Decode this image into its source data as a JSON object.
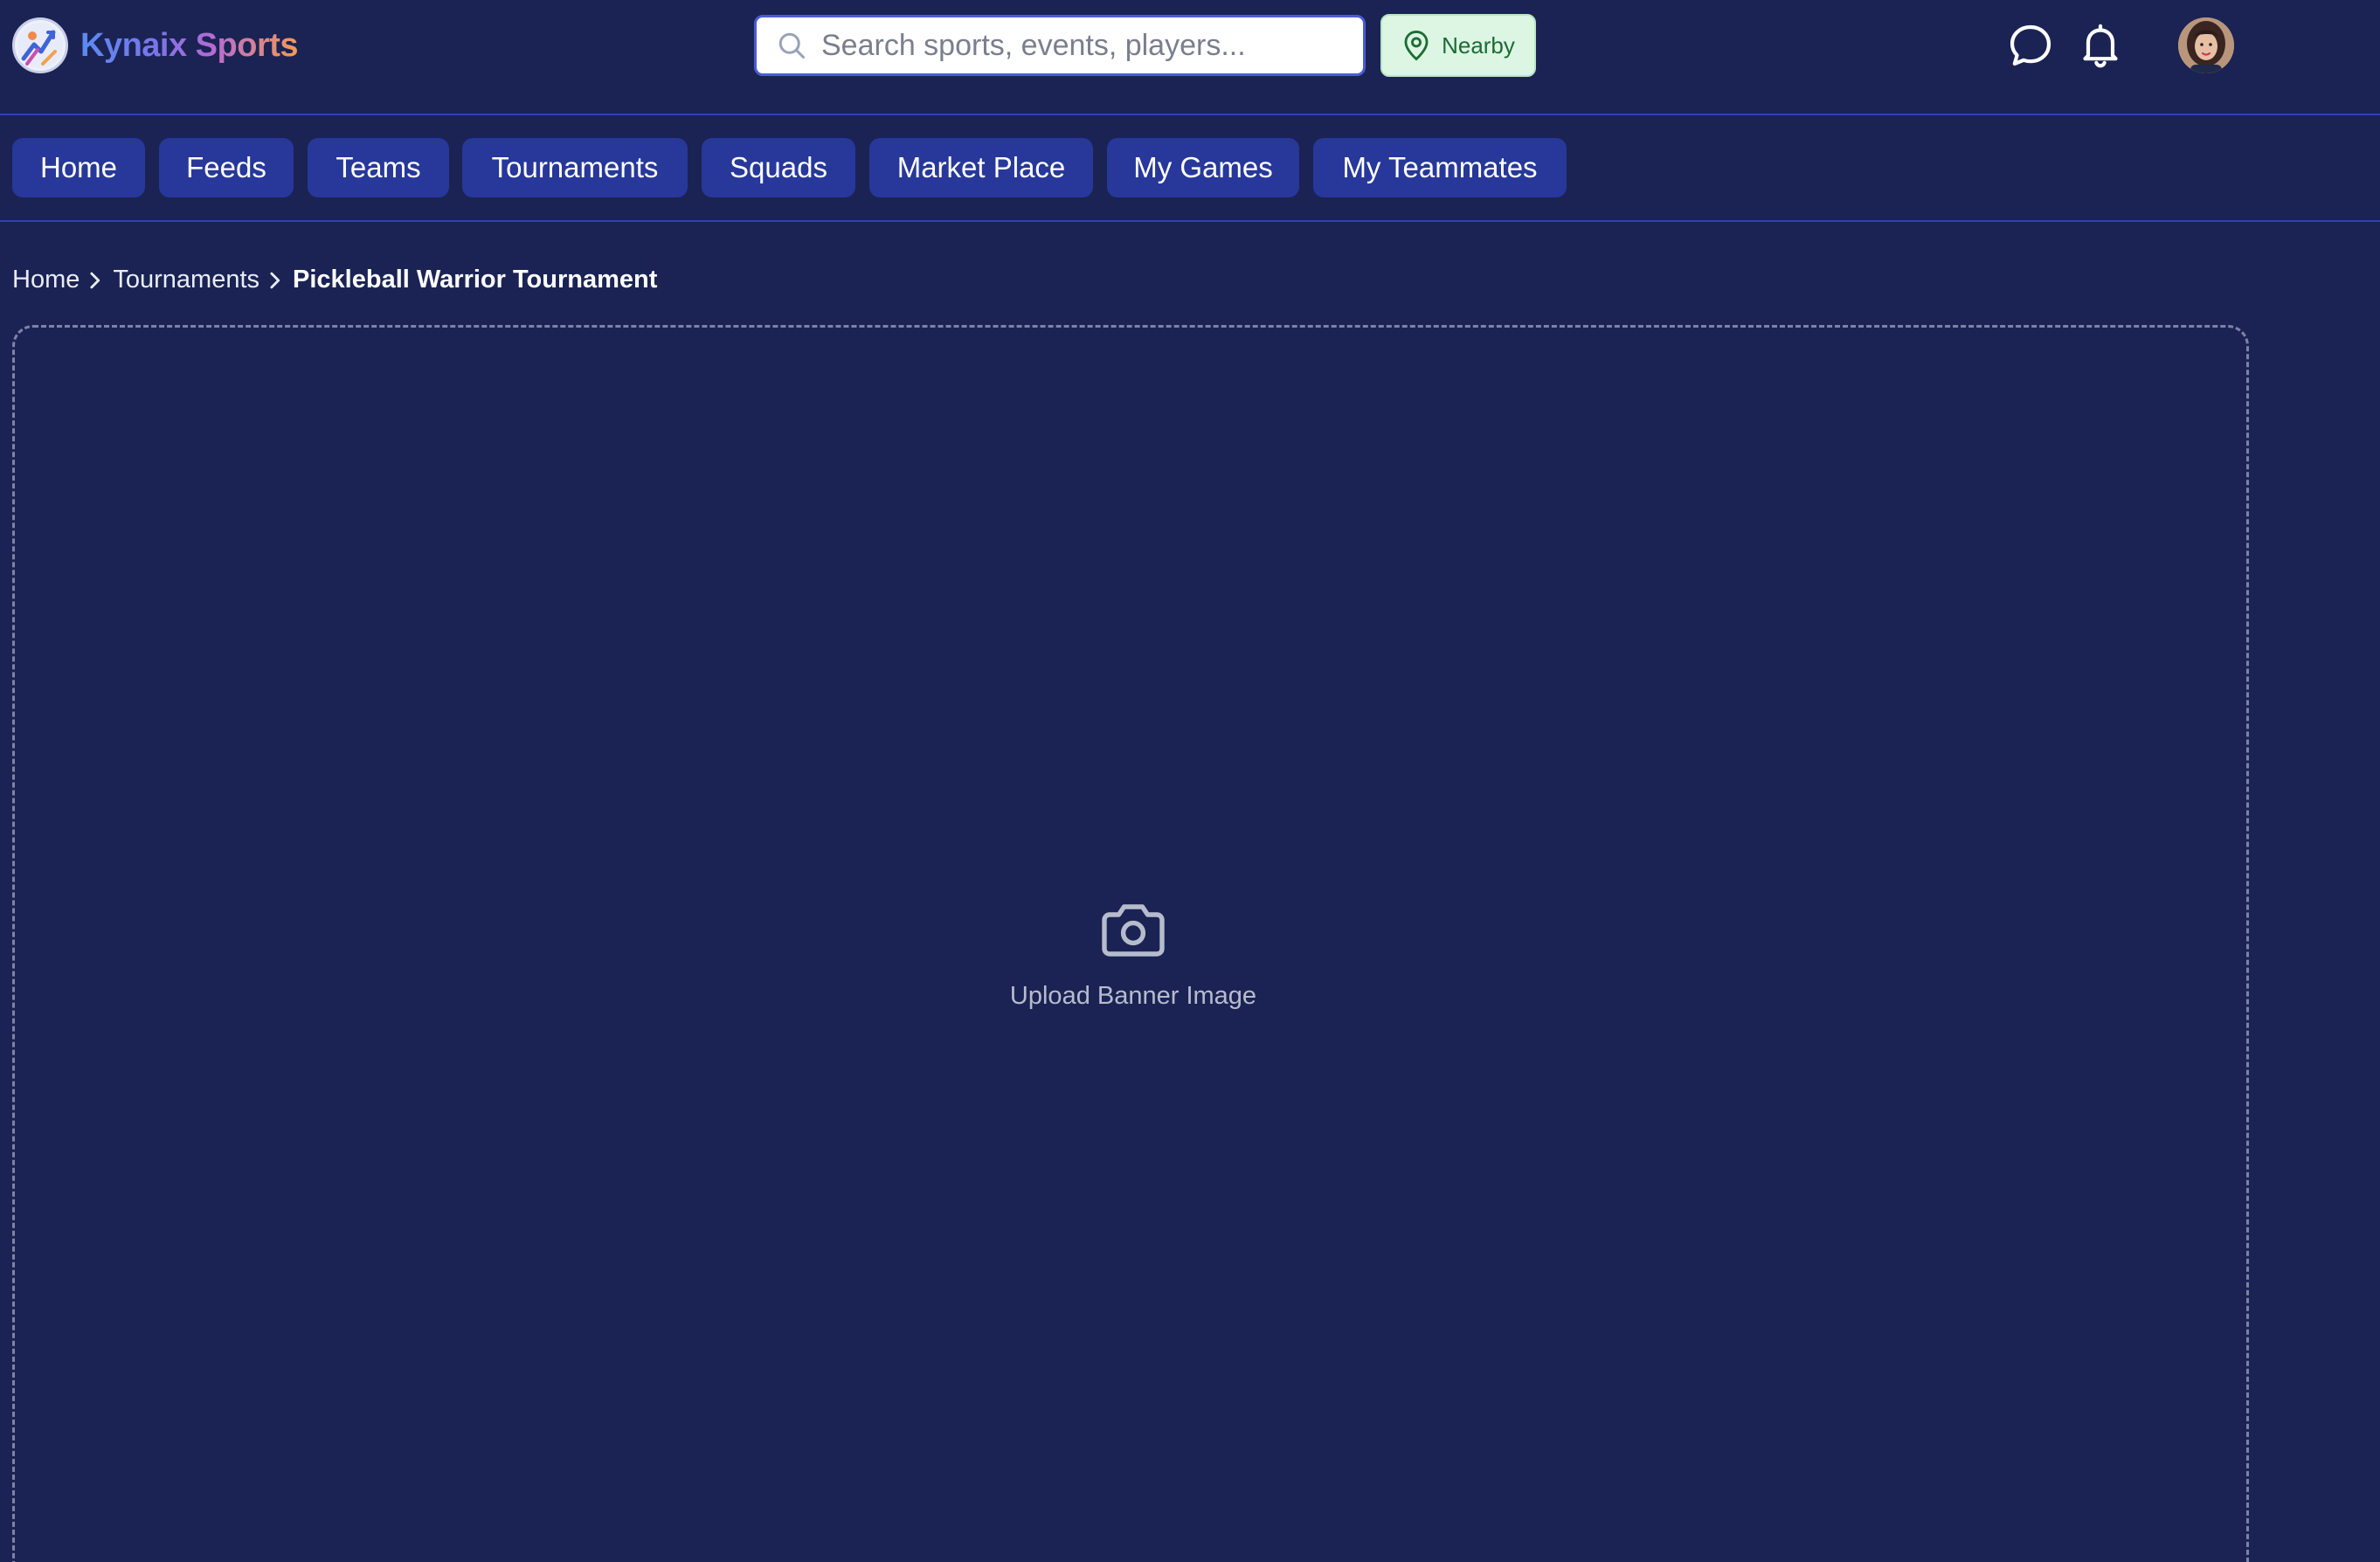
{
  "brand": {
    "name": "Kynaix Sports"
  },
  "search": {
    "placeholder": "Search sports, events, players..."
  },
  "nearby": {
    "label": "Nearby"
  },
  "nav": {
    "items": [
      {
        "label": "Home"
      },
      {
        "label": "Feeds"
      },
      {
        "label": "Teams"
      },
      {
        "label": "Tournaments"
      },
      {
        "label": "Squads"
      },
      {
        "label": "Market Place"
      },
      {
        "label": "My Games"
      },
      {
        "label": "My Teammates"
      }
    ]
  },
  "breadcrumb": {
    "items": [
      "Home",
      "Tournaments"
    ],
    "current": "Pickleball Warrior Tournament"
  },
  "banner": {
    "upload_label": "Upload Banner Image"
  },
  "icons": {
    "search": "search-icon",
    "location": "map-pin-icon",
    "messages": "chat-bubble-icon",
    "notifications": "bell-icon",
    "upload": "camera-icon"
  },
  "colors": {
    "background": "#1a2353",
    "nav_button": "#27389a",
    "divider": "#2f40b6",
    "nearby_bg": "#dcf6e3",
    "nearby_text": "#1d6b34"
  }
}
